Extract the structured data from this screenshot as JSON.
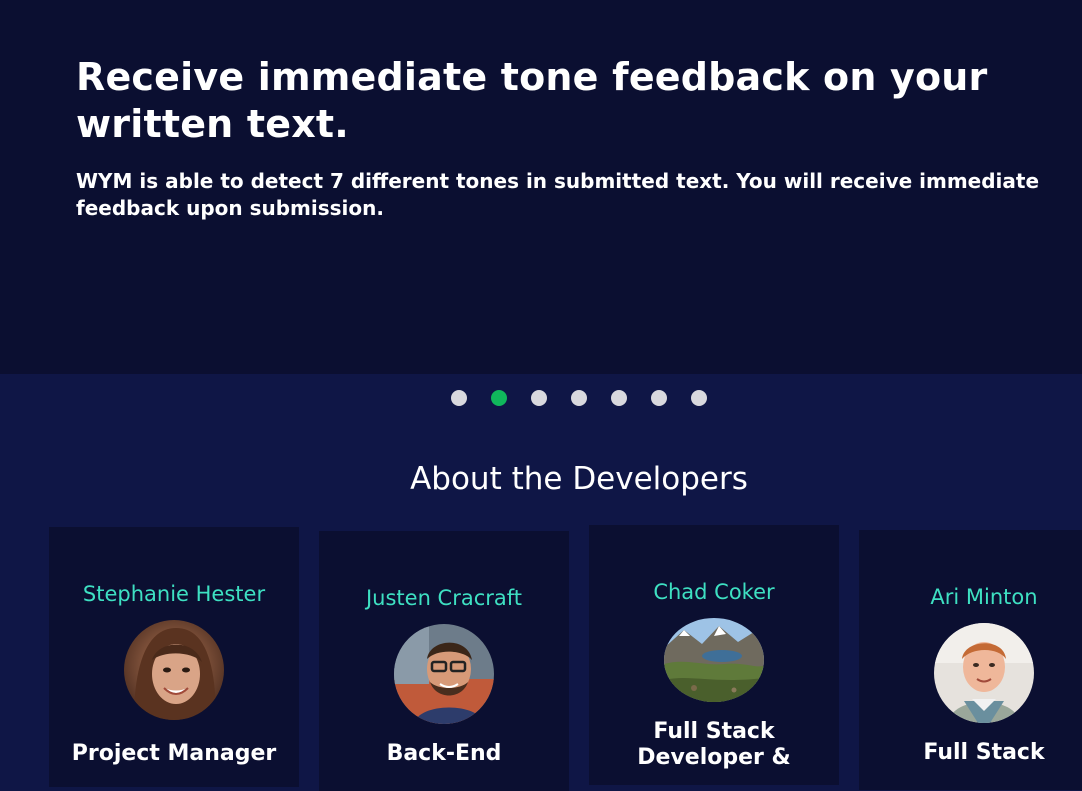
{
  "hero": {
    "title": "Receive immediate tone feedback on your written text.",
    "description": "WYM is able to detect 7 different tones in submitted text. You will receive immediate feedback upon submission."
  },
  "carousel": {
    "slide_count": 7,
    "active_index": 1,
    "active_color": "#10b75c",
    "inactive_color": "#d9d9de"
  },
  "about": {
    "title": "About the Developers",
    "developers": [
      {
        "name": "Stephanie Hester",
        "role": "Project Manager",
        "avatar_icon": "person-photo-icon"
      },
      {
        "name": "Justen Cracraft",
        "role": "Back-End",
        "avatar_icon": "person-photo-icon"
      },
      {
        "name": "Chad Coker",
        "role": "Full Stack Developer &",
        "avatar_icon": "mountain-landscape-icon"
      },
      {
        "name": "Ari Minton",
        "role": "Full Stack",
        "avatar_icon": "person-photo-icon"
      }
    ]
  },
  "colors": {
    "hero_bg": "#0b0f31",
    "page_bg": "#0f1646",
    "name_accent": "#3ee0c2"
  }
}
